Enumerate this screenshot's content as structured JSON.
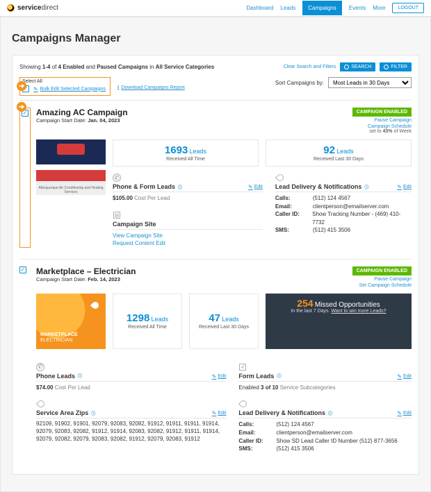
{
  "header": {
    "brand_bold": "service",
    "brand_light": "direct",
    "nav": {
      "dashboard": "Dashboard",
      "leads": "Leads",
      "campaigns": "Campaigns",
      "events": "Events",
      "more": "More"
    },
    "logout": "LOGOUT"
  },
  "page_title": "Campaigns Manager",
  "summary": {
    "showing_prefix": "Showing ",
    "range": "1-4",
    "of_text": " of ",
    "total": "4",
    "enabled_text": " Enabled",
    "and_text": " and ",
    "paused_text": "Paused Campaigns",
    "in_text": " in ",
    "categories": "All Service Categories"
  },
  "controls": {
    "clear": "Clear Search and Filters",
    "search": "SEARCH",
    "filter": "FILTER",
    "select_all": "Select All",
    "bulk_edit": "Bulk Edit Selected Campaigns",
    "download": "Download Campaigns Report",
    "sort_label": "Sort Campaigns by:",
    "sort_value": "Most Leads in 30 Days"
  },
  "labels": {
    "leads": "Leads",
    "received_all": "Received All Time",
    "received_30": "Received Last 30 Days",
    "edit": "Edit",
    "start_date": "Campaign Start Date: ",
    "enabled_badge": "CAMPAIGN ENABLED",
    "pause": "Pause Campaign",
    "set_schedule": "Set Campaign Schedule",
    "schedule_prefix": "Campaign Schedule",
    "schedule_mid": " set to ",
    "schedule_suffix": " of Week",
    "missed_unit": "Missed Opportunities",
    "missed_sub_pre": "In the last 7 Days. ",
    "missed_sub_link": "Want to win more Leads?"
  },
  "campaigns": [
    {
      "name": "Amazing AC Campaign",
      "start_date": "Jan. 04, 2023",
      "schedule_pct": "43%",
      "thumb_caption": "Albuquerque Air Conditioning and Heating Services",
      "stats": {
        "all_time": "1693",
        "last30": "92"
      },
      "lead_type": {
        "title": "Phone & Form Leads",
        "cost": "$105.00",
        "cost_label": "Cost Per Lead"
      },
      "site": {
        "title": "Campaign Site",
        "view": "View Campaign Site",
        "request": "Request Content Edit"
      },
      "delivery": {
        "title": "Lead Delivery & Notifications",
        "calls": "(512) 124 4567",
        "email": "clientperson@emailserver.com",
        "caller_id": "Show Tracking Number - (469) 410-7732",
        "sms": "(512) 415 3506"
      }
    },
    {
      "name": "Marketplace – Electrician",
      "start_date": "Feb. 14, 2023",
      "thumb_title1": "MARKETPLACE",
      "thumb_title2": "ELECTRICIAN",
      "stats": {
        "all_time": "1298",
        "last30": "47"
      },
      "missed": {
        "count": "254"
      },
      "phone_leads": {
        "title": "Phone Leads",
        "cost": "$74.00",
        "cost_label": "Cost Per Lead"
      },
      "form_leads": {
        "title": "Form Leads",
        "enabled_pre": "Enabled ",
        "enabled_count": "3 of 10",
        "enabled_post": " Service Subcategories"
      },
      "zips": {
        "title": "Service Area Zips",
        "list": "92109, 91902, 91901, 92079, 92083, 92082, 91912, 91911, 91911, 91914, 92079, 92083, 92082, 91912, 91914, 92083, 92082, 91912, 91911, 91914, 92079, 92082, 92079, 92083, 92082, 91912, 92079, 92083, 91912"
      },
      "delivery": {
        "title": "Lead Delivery & Notifications",
        "calls": "(512) 124 4567",
        "email": "clientperson@emailserver.com",
        "caller_id": "Show SD Lead Caller ID Number (512) 877-3656",
        "sms": "(512) 415 3506"
      }
    }
  ],
  "kv_labels": {
    "calls": "Calls:",
    "email": "Email:",
    "caller_id": "Caller ID:",
    "sms": "SMS:"
  }
}
